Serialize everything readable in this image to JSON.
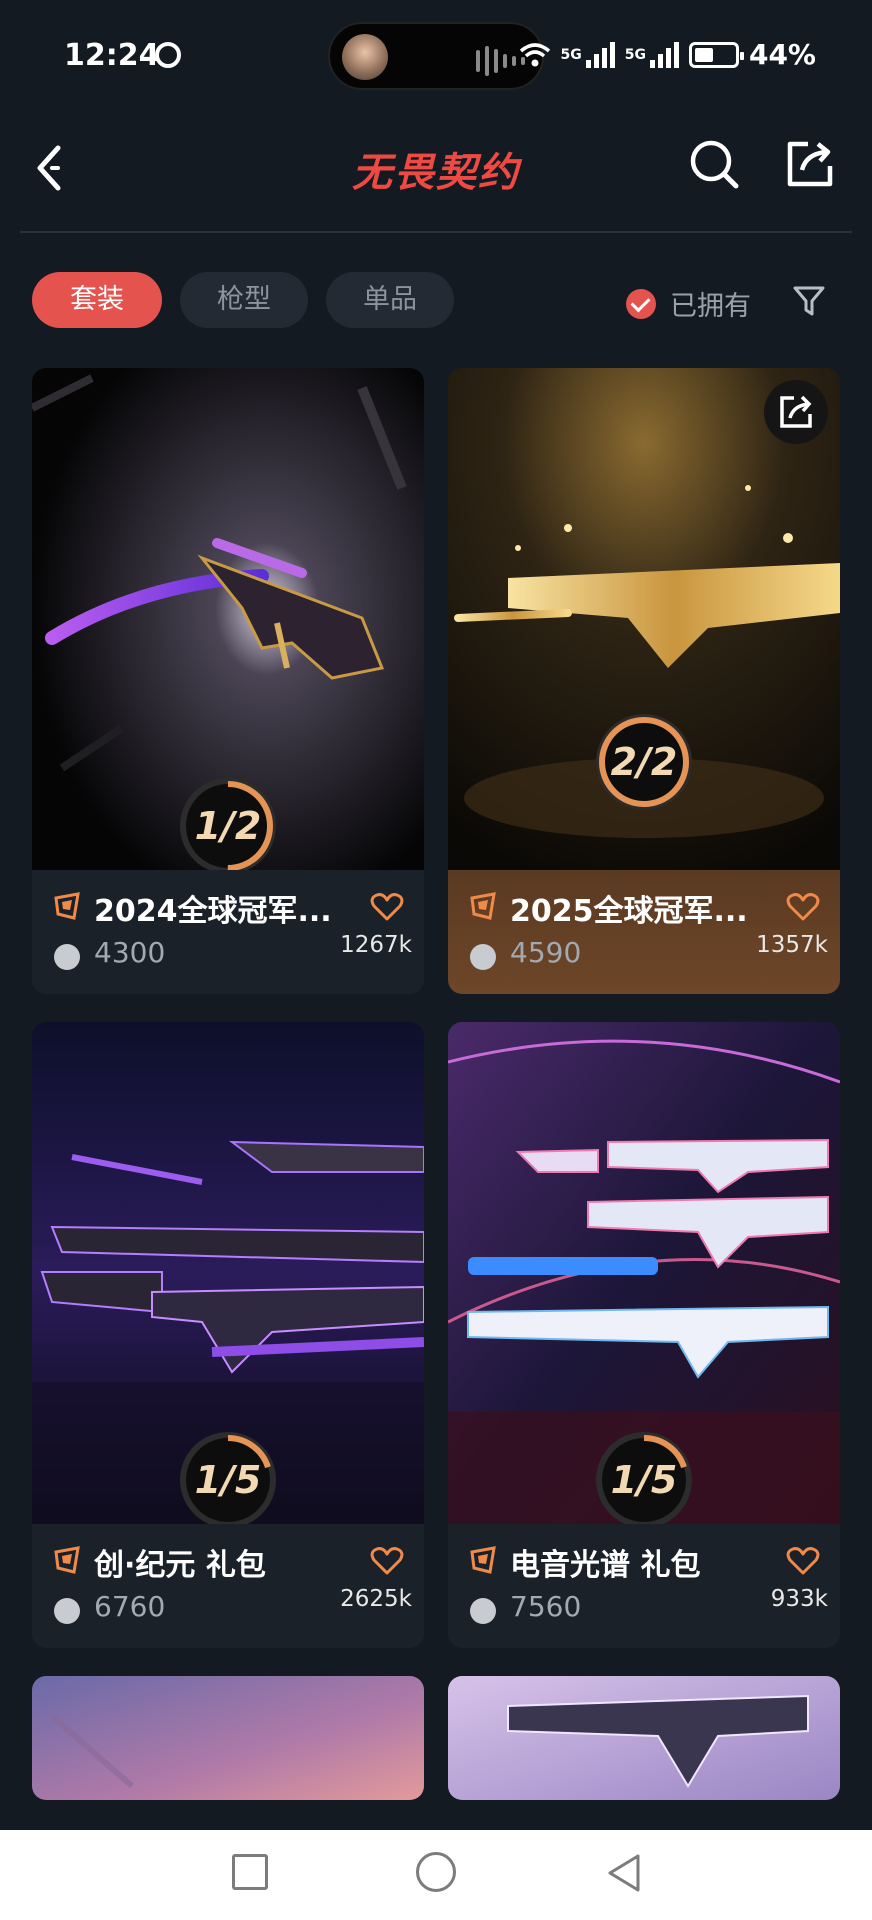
{
  "status_bar": {
    "time": "12:24",
    "battery": "44%",
    "network1": "5G",
    "network2": "5G"
  },
  "header": {
    "title": "无畏契约"
  },
  "filters": {
    "tabs": [
      {
        "label": "套装",
        "active": true
      },
      {
        "label": "枪型",
        "active": false
      },
      {
        "label": "单品",
        "active": false
      }
    ],
    "owned_label": "已拥有"
  },
  "cards": [
    {
      "name": "2024全球冠军...",
      "price": "4300",
      "likes": "1267k",
      "badge": "1/2",
      "progress": 0.5,
      "accent": "#2a1f3a"
    },
    {
      "name": "2025全球冠军...",
      "price": "4590",
      "likes": "1357k",
      "badge": "2/2",
      "progress": 1.0,
      "accent": "#6b4225"
    },
    {
      "name": "创·纪元 礼包",
      "price": "6760",
      "likes": "2625k",
      "badge": "1/5",
      "progress": 0.2,
      "accent": "#1b2129"
    },
    {
      "name": "电音光谱 礼包",
      "price": "7560",
      "likes": "933k",
      "badge": "1/5",
      "progress": 0.2,
      "accent": "#1b2129"
    }
  ],
  "colors": {
    "brand": "#ee4a43",
    "progress_ring": "#e59455",
    "background": "#131a22"
  }
}
